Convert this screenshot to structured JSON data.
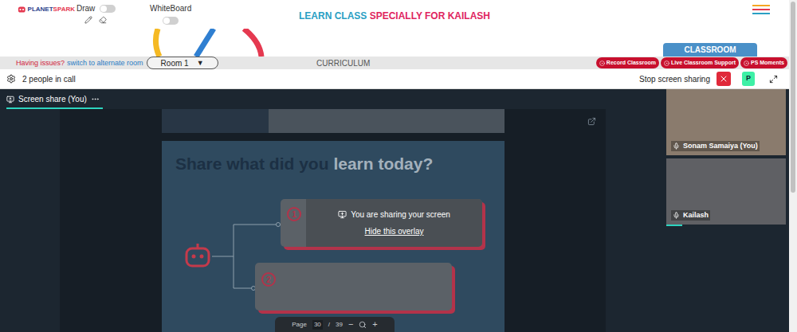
{
  "header": {
    "logo": {
      "first": "PLANET",
      "second": "SPARK"
    },
    "draw": {
      "label": "Draw",
      "on": false
    },
    "whiteboard": {
      "label": "WhiteBoard",
      "on": false
    },
    "title": {
      "lead": "LEARN CLASS",
      "rest": "SPECIALLY FOR KAILASH"
    }
  },
  "classroom_button": "CLASSROOM",
  "room_bar": {
    "issues": "Having issues?",
    "switch": "switch to alternate room",
    "room": "Room 1",
    "caret": "▼",
    "tab": "CURRICULUM",
    "actions": [
      "Record Classroom",
      "Live Classroom Support",
      "PS Moments"
    ]
  },
  "call_bar": {
    "people": "2 people in call",
    "stop": "Stop screen sharing",
    "avatar": "P"
  },
  "stage": {
    "tab": {
      "label": "Screen share (You)",
      "selected": true
    }
  },
  "slide": {
    "heading_a": "Share what did you",
    "heading_b": "learn today?",
    "items": [
      {
        "number": "1"
      },
      {
        "number": "2"
      }
    ]
  },
  "overlay": {
    "message": "You are sharing your screen",
    "hide": "Hide this overlay"
  },
  "pager": {
    "label": "Page",
    "current": "30",
    "separator": "/",
    "total": "39",
    "zoom_out": "−",
    "zoom_in": "+"
  },
  "participants": [
    {
      "name": "Sonam Samaiya (You)",
      "speaking": false
    },
    {
      "name": "Kailash",
      "speaking": true
    }
  ]
}
